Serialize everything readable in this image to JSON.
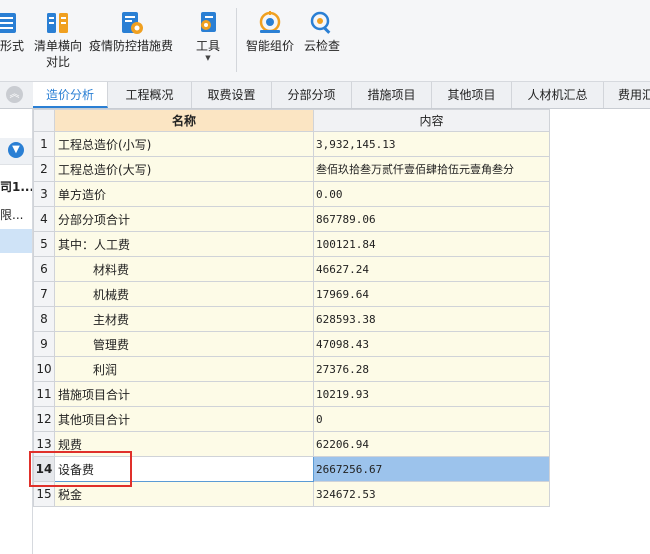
{
  "toolbar": {
    "buttons": [
      {
        "label": "形式",
        "label2": "",
        "icon": "form-style-icon"
      },
      {
        "label": "清单横向",
        "label2": "对比",
        "icon": "list-compare-icon"
      },
      {
        "label": "疫情防控措施费",
        "label2": "",
        "icon": "epidemic-measures-icon"
      },
      {
        "label": "工具",
        "label2": "",
        "icon": "tools-icon"
      },
      {
        "label": "智能组价",
        "label2": "",
        "icon": "smart-pricing-icon"
      },
      {
        "label": "云检查",
        "label2": "",
        "icon": "cloud-check-icon"
      }
    ]
  },
  "tabs": [
    {
      "label": "造价分析",
      "active": true
    },
    {
      "label": "工程概况",
      "active": false
    },
    {
      "label": "取费设置",
      "active": false
    },
    {
      "label": "分部分项",
      "active": false
    },
    {
      "label": "措施项目",
      "active": false
    },
    {
      "label": "其他项目",
      "active": false
    },
    {
      "label": "人材机汇总",
      "active": false
    },
    {
      "label": "费用汇",
      "active": false
    }
  ],
  "left_panel": {
    "items": [
      "司1...",
      "限..."
    ]
  },
  "table": {
    "headers": [
      "名称",
      "内容"
    ],
    "rows": [
      {
        "no": "1",
        "name": "工程总造价(小写)",
        "value": "3,932,145.13",
        "indent": false
      },
      {
        "no": "2",
        "name": "工程总造价(大写)",
        "value": "叁佰玖拾叁万贰仟壹佰肆拾伍元壹角叁分",
        "indent": false
      },
      {
        "no": "3",
        "name": "单方造价",
        "value": "0.00",
        "indent": false
      },
      {
        "no": "4",
        "name": "分部分项合计",
        "value": "867789.06",
        "indent": false
      },
      {
        "no": "5",
        "name": "其中：人工费",
        "value": "100121.84",
        "indent": false
      },
      {
        "no": "6",
        "name": "材料费",
        "value": "46627.24",
        "indent": true
      },
      {
        "no": "7",
        "name": "机械费",
        "value": "17969.64",
        "indent": true
      },
      {
        "no": "8",
        "name": "主材费",
        "value": "628593.38",
        "indent": true
      },
      {
        "no": "9",
        "name": "管理费",
        "value": "47098.43",
        "indent": true
      },
      {
        "no": "10",
        "name": "利润",
        "value": "27376.28",
        "indent": true
      },
      {
        "no": "11",
        "name": "措施项目合计",
        "value": "10219.93",
        "indent": false
      },
      {
        "no": "12",
        "name": "其他项目合计",
        "value": "0",
        "indent": false
      },
      {
        "no": "13",
        "name": "规费",
        "value": "62206.94",
        "indent": false
      },
      {
        "no": "14",
        "name": "设备费",
        "value": "2667256.67",
        "indent": false,
        "selected": true
      },
      {
        "no": "15",
        "name": "税金",
        "value": "324672.53",
        "indent": false
      }
    ]
  },
  "colors": {
    "accent": "#2a7fd4",
    "highlight_box": "#e0302a",
    "selected_cell": "#9cc3ec",
    "cell_bg": "#fdfbe7",
    "header_highlight": "#fbe5c3"
  }
}
